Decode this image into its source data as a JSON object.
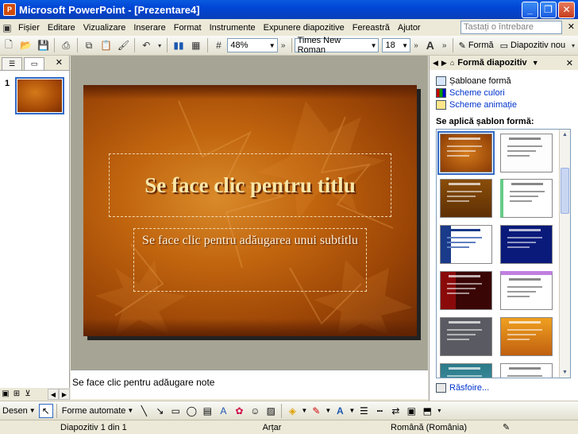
{
  "window": {
    "title": "Microsoft PowerPoint - [Prezentare4]",
    "app_icon": "P",
    "controls": [
      "_",
      "❐",
      "✕"
    ]
  },
  "menu": {
    "items": [
      "Fișier",
      "Editare",
      "Vizualizare",
      "Inserare",
      "Format",
      "Instrumente",
      "Expunere diapozitive",
      "Fereastră",
      "Ajutor"
    ],
    "help_placeholder": "Tastați o întrebare"
  },
  "toolbar": {
    "zoom": "48%",
    "font_name": "Times New Roman",
    "font_size": "18",
    "layout_label": "Formă",
    "new_slide_label": "Diapozitiv nou"
  },
  "slides_panel": {
    "slide_number": "1"
  },
  "slide": {
    "title_placeholder": "Se face clic pentru titlu",
    "subtitle_placeholder": "Se face clic pentru adăugarea unui subtitlu"
  },
  "notes": {
    "placeholder": "Se face clic pentru adăugare note"
  },
  "task_pane": {
    "title": "Formă diapozitiv",
    "links": [
      "Șabloane formă",
      "Scheme culori",
      "Scheme animație"
    ],
    "section_title": "Se aplică șablon formă:",
    "browse_label": "Răsfoire..."
  },
  "drawing_toolbar": {
    "draw_label": "Desen",
    "autoshapes_label": "Forme automate"
  },
  "status": {
    "slide_info": "Diapozitiv 1 din 1",
    "template": "Arțar",
    "language": "Română (România)"
  },
  "colors": {
    "titlebar": "#0a5ae0",
    "slide_orange": "#c0640e",
    "selection": "#316ac5"
  }
}
